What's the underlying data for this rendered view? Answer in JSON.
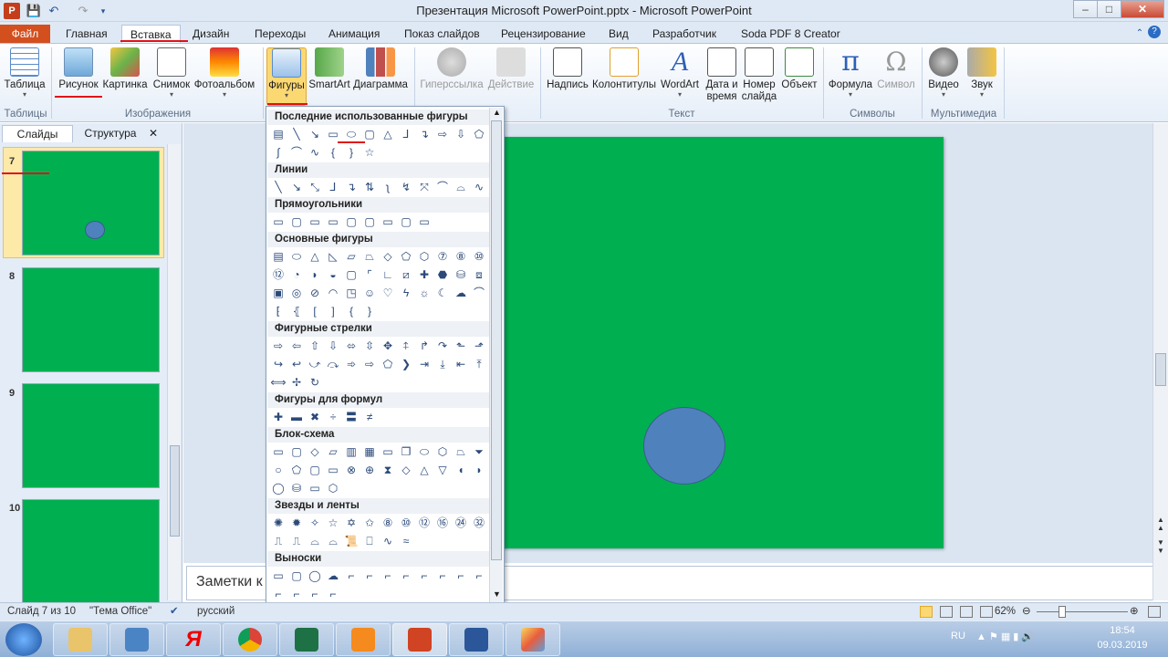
{
  "window": {
    "title": "Презентация Microsoft PowerPoint.pptx  -  Microsoft PowerPoint",
    "controls": {
      "minimize": "–",
      "maximize": "□",
      "close": "✕"
    }
  },
  "tabs": [
    "Файл",
    "Главная",
    "Вставка",
    "Дизайн",
    "Переходы",
    "Анимация",
    "Показ слайдов",
    "Рецензирование",
    "Вид",
    "Разработчик",
    "Soda PDF 8 Creator"
  ],
  "ribbon": {
    "tables": {
      "table": "Таблица",
      "group": "Таблицы"
    },
    "images": {
      "picture": "Рисунок",
      "clipart": "Картинка",
      "screenshot": "Снимок",
      "album": "Фотоальбом",
      "group": "Изображения"
    },
    "illustrations": {
      "shapes": "Фигуры",
      "smartart": "SmartArt",
      "chart": "Диаграмма"
    },
    "links": {
      "hyperlink": "Гиперссылка",
      "action": "Действие"
    },
    "text": {
      "textbox": "Надпись",
      "headerfooter": "Колонтитулы",
      "wordart": "WordArt",
      "datetime1": "Дата и",
      "datetime2": "время",
      "slidenum1": "Номер",
      "slidenum2": "слайда",
      "object": "Объект",
      "group": "Текст"
    },
    "symbols": {
      "equation": "Формула",
      "symbol": "Символ",
      "group": "Символы"
    },
    "media": {
      "video": "Видео",
      "audio": "Звук",
      "group": "Мультимедиа"
    }
  },
  "leftpane": {
    "tabs": [
      "Слайды",
      "Структура"
    ],
    "slides": [
      "7",
      "8",
      "9",
      "10"
    ]
  },
  "gallery": {
    "sections": [
      "Последние использованные фигуры",
      "Линии",
      "Прямоугольники",
      "Основные фигуры",
      "Фигурные стрелки",
      "Фигуры для формул",
      "Блок-схема",
      "Звезды и ленты",
      "Выноски"
    ]
  },
  "notes": {
    "placeholder": "Заметки к"
  },
  "status": {
    "slide": "Слайд 7 из 10",
    "theme": "\"Тема Office\"",
    "language": "русский",
    "zoom": "62%"
  },
  "taskbar": {
    "lang": "RU",
    "time": "18:54",
    "date": "09.03.2019"
  },
  "colors": {
    "slide_bg": "#00b050",
    "shape_fill": "#4f81bd",
    "file_tab": "#d34f1e",
    "highlight": "#e0121a"
  }
}
